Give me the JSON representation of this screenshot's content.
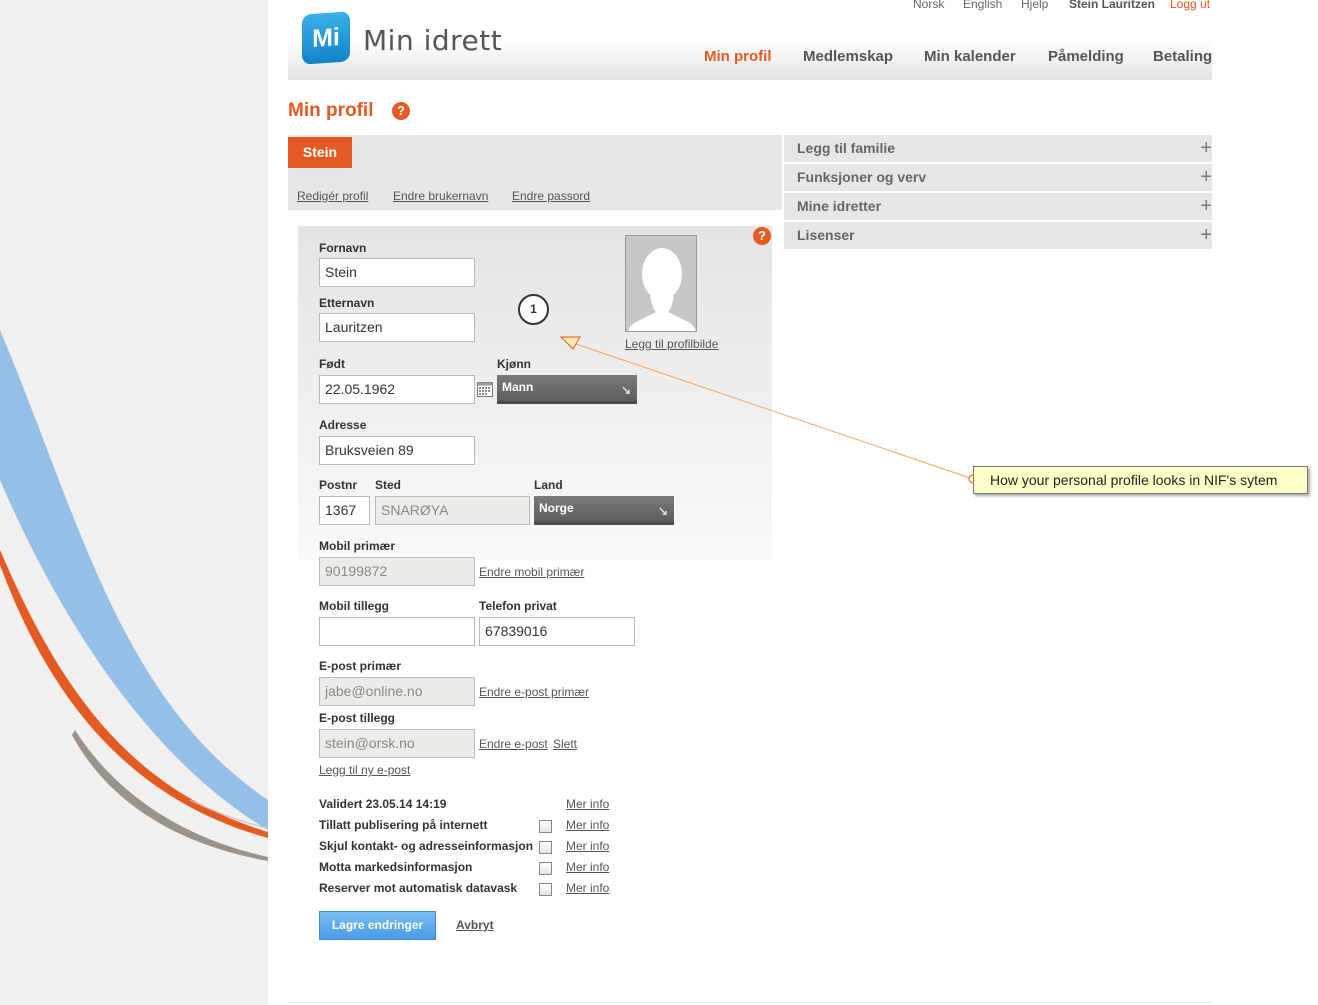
{
  "top_links": {
    "norsk": "Norsk",
    "english": "English",
    "help": "Hjelp",
    "user": "Stein Lauritzen",
    "logout": "Logg ut"
  },
  "logo": {
    "mark": "Mi",
    "text": "Min idrett"
  },
  "nav": {
    "items": [
      "Min profil",
      "Medlemskap",
      "Min kalender",
      "Påmelding",
      "Betaling"
    ],
    "active": "Min profil"
  },
  "page": {
    "title": "Min profil",
    "help": "?"
  },
  "profile_tab": "Stein",
  "profile_links": {
    "edit": "Redigér profil",
    "change_username": "Endre brukernavn",
    "change_password": "Endre passord"
  },
  "form": {
    "help": "?",
    "first_name": {
      "label": "Fornavn",
      "value": "Stein"
    },
    "last_name": {
      "label": "Etternavn",
      "value": "Lauritzen"
    },
    "born": {
      "label": "Født",
      "value": "22.05.1962"
    },
    "gender": {
      "label": "Kjønn",
      "value": "Mann"
    },
    "address": {
      "label": "Adresse",
      "value": "Bruksveien 89"
    },
    "postal_code": {
      "label": "Postnr",
      "value": "1367"
    },
    "place": {
      "label": "Sted",
      "value": "SNARØYA"
    },
    "country": {
      "label": "Land",
      "value": "Norge"
    },
    "mobile_primary": {
      "label": "Mobil primær",
      "value": "90199872",
      "link": "Endre mobil primær"
    },
    "mobile_extra": {
      "label": "Mobil tillegg",
      "value": ""
    },
    "phone_private": {
      "label": "Telefon privat",
      "value": "67839016"
    },
    "email_primary": {
      "label": "E-post primær",
      "value": "jabe@online.no",
      "link": "Endre e-post primær"
    },
    "email_extra": {
      "label": "E-post tillegg",
      "value": "stein@orsk.no",
      "link_change": "Endre e-post",
      "link_delete": "Slett"
    },
    "add_email": "Legg til ny e-post",
    "add_picture": "Legg til profilbilde"
  },
  "settings": {
    "validated": "Validert 23.05.14 14:19",
    "more_info": "Mer info",
    "items": [
      {
        "label": "Tillatt publisering på internett",
        "checked": false
      },
      {
        "label": "Skjul kontakt- og adresseinformasjon",
        "checked": false
      },
      {
        "label": "Motta markedsinformasjon",
        "checked": false
      },
      {
        "label": "Reserver mot automatisk datavask",
        "checked": false
      }
    ]
  },
  "actions": {
    "save": "Lagre endringer",
    "cancel": "Avbryt"
  },
  "accordion": {
    "plus": "+",
    "items": [
      "Legg til familie",
      "Funksjoner og verv",
      "Mine idretter",
      "Lisenser"
    ]
  },
  "annotation": {
    "number": "1",
    "text": "How your personal profile looks in NIF's sytem"
  },
  "colors": {
    "accent": "#e35a22",
    "brand_blue": "#1d96d8",
    "button_blue": "#4a9be6"
  }
}
